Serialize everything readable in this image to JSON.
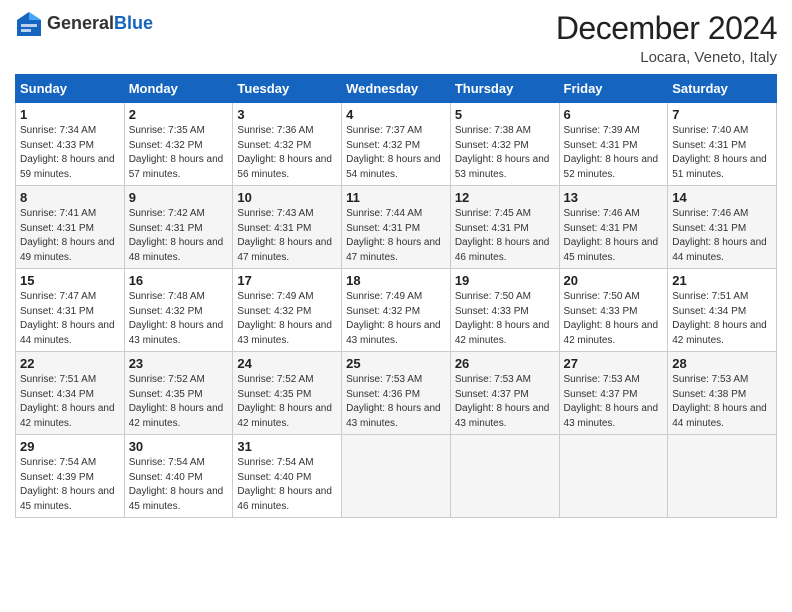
{
  "header": {
    "logo_general": "General",
    "logo_blue": "Blue",
    "month_title": "December 2024",
    "location": "Locara, Veneto, Italy"
  },
  "days_of_week": [
    "Sunday",
    "Monday",
    "Tuesday",
    "Wednesday",
    "Thursday",
    "Friday",
    "Saturday"
  ],
  "weeks": [
    [
      {
        "day": "1",
        "sunrise": "Sunrise: 7:34 AM",
        "sunset": "Sunset: 4:33 PM",
        "daylight": "Daylight: 8 hours and 59 minutes."
      },
      {
        "day": "2",
        "sunrise": "Sunrise: 7:35 AM",
        "sunset": "Sunset: 4:32 PM",
        "daylight": "Daylight: 8 hours and 57 minutes."
      },
      {
        "day": "3",
        "sunrise": "Sunrise: 7:36 AM",
        "sunset": "Sunset: 4:32 PM",
        "daylight": "Daylight: 8 hours and 56 minutes."
      },
      {
        "day": "4",
        "sunrise": "Sunrise: 7:37 AM",
        "sunset": "Sunset: 4:32 PM",
        "daylight": "Daylight: 8 hours and 54 minutes."
      },
      {
        "day": "5",
        "sunrise": "Sunrise: 7:38 AM",
        "sunset": "Sunset: 4:32 PM",
        "daylight": "Daylight: 8 hours and 53 minutes."
      },
      {
        "day": "6",
        "sunrise": "Sunrise: 7:39 AM",
        "sunset": "Sunset: 4:31 PM",
        "daylight": "Daylight: 8 hours and 52 minutes."
      },
      {
        "day": "7",
        "sunrise": "Sunrise: 7:40 AM",
        "sunset": "Sunset: 4:31 PM",
        "daylight": "Daylight: 8 hours and 51 minutes."
      }
    ],
    [
      {
        "day": "8",
        "sunrise": "Sunrise: 7:41 AM",
        "sunset": "Sunset: 4:31 PM",
        "daylight": "Daylight: 8 hours and 49 minutes."
      },
      {
        "day": "9",
        "sunrise": "Sunrise: 7:42 AM",
        "sunset": "Sunset: 4:31 PM",
        "daylight": "Daylight: 8 hours and 48 minutes."
      },
      {
        "day": "10",
        "sunrise": "Sunrise: 7:43 AM",
        "sunset": "Sunset: 4:31 PM",
        "daylight": "Daylight: 8 hours and 47 minutes."
      },
      {
        "day": "11",
        "sunrise": "Sunrise: 7:44 AM",
        "sunset": "Sunset: 4:31 PM",
        "daylight": "Daylight: 8 hours and 47 minutes."
      },
      {
        "day": "12",
        "sunrise": "Sunrise: 7:45 AM",
        "sunset": "Sunset: 4:31 PM",
        "daylight": "Daylight: 8 hours and 46 minutes."
      },
      {
        "day": "13",
        "sunrise": "Sunrise: 7:46 AM",
        "sunset": "Sunset: 4:31 PM",
        "daylight": "Daylight: 8 hours and 45 minutes."
      },
      {
        "day": "14",
        "sunrise": "Sunrise: 7:46 AM",
        "sunset": "Sunset: 4:31 PM",
        "daylight": "Daylight: 8 hours and 44 minutes."
      }
    ],
    [
      {
        "day": "15",
        "sunrise": "Sunrise: 7:47 AM",
        "sunset": "Sunset: 4:31 PM",
        "daylight": "Daylight: 8 hours and 44 minutes."
      },
      {
        "day": "16",
        "sunrise": "Sunrise: 7:48 AM",
        "sunset": "Sunset: 4:32 PM",
        "daylight": "Daylight: 8 hours and 43 minutes."
      },
      {
        "day": "17",
        "sunrise": "Sunrise: 7:49 AM",
        "sunset": "Sunset: 4:32 PM",
        "daylight": "Daylight: 8 hours and 43 minutes."
      },
      {
        "day": "18",
        "sunrise": "Sunrise: 7:49 AM",
        "sunset": "Sunset: 4:32 PM",
        "daylight": "Daylight: 8 hours and 43 minutes."
      },
      {
        "day": "19",
        "sunrise": "Sunrise: 7:50 AM",
        "sunset": "Sunset: 4:33 PM",
        "daylight": "Daylight: 8 hours and 42 minutes."
      },
      {
        "day": "20",
        "sunrise": "Sunrise: 7:50 AM",
        "sunset": "Sunset: 4:33 PM",
        "daylight": "Daylight: 8 hours and 42 minutes."
      },
      {
        "day": "21",
        "sunrise": "Sunrise: 7:51 AM",
        "sunset": "Sunset: 4:34 PM",
        "daylight": "Daylight: 8 hours and 42 minutes."
      }
    ],
    [
      {
        "day": "22",
        "sunrise": "Sunrise: 7:51 AM",
        "sunset": "Sunset: 4:34 PM",
        "daylight": "Daylight: 8 hours and 42 minutes."
      },
      {
        "day": "23",
        "sunrise": "Sunrise: 7:52 AM",
        "sunset": "Sunset: 4:35 PM",
        "daylight": "Daylight: 8 hours and 42 minutes."
      },
      {
        "day": "24",
        "sunrise": "Sunrise: 7:52 AM",
        "sunset": "Sunset: 4:35 PM",
        "daylight": "Daylight: 8 hours and 42 minutes."
      },
      {
        "day": "25",
        "sunrise": "Sunrise: 7:53 AM",
        "sunset": "Sunset: 4:36 PM",
        "daylight": "Daylight: 8 hours and 43 minutes."
      },
      {
        "day": "26",
        "sunrise": "Sunrise: 7:53 AM",
        "sunset": "Sunset: 4:37 PM",
        "daylight": "Daylight: 8 hours and 43 minutes."
      },
      {
        "day": "27",
        "sunrise": "Sunrise: 7:53 AM",
        "sunset": "Sunset: 4:37 PM",
        "daylight": "Daylight: 8 hours and 43 minutes."
      },
      {
        "day": "28",
        "sunrise": "Sunrise: 7:53 AM",
        "sunset": "Sunset: 4:38 PM",
        "daylight": "Daylight: 8 hours and 44 minutes."
      }
    ],
    [
      {
        "day": "29",
        "sunrise": "Sunrise: 7:54 AM",
        "sunset": "Sunset: 4:39 PM",
        "daylight": "Daylight: 8 hours and 45 minutes."
      },
      {
        "day": "30",
        "sunrise": "Sunrise: 7:54 AM",
        "sunset": "Sunset: 4:40 PM",
        "daylight": "Daylight: 8 hours and 45 minutes."
      },
      {
        "day": "31",
        "sunrise": "Sunrise: 7:54 AM",
        "sunset": "Sunset: 4:40 PM",
        "daylight": "Daylight: 8 hours and 46 minutes."
      },
      null,
      null,
      null,
      null
    ]
  ]
}
